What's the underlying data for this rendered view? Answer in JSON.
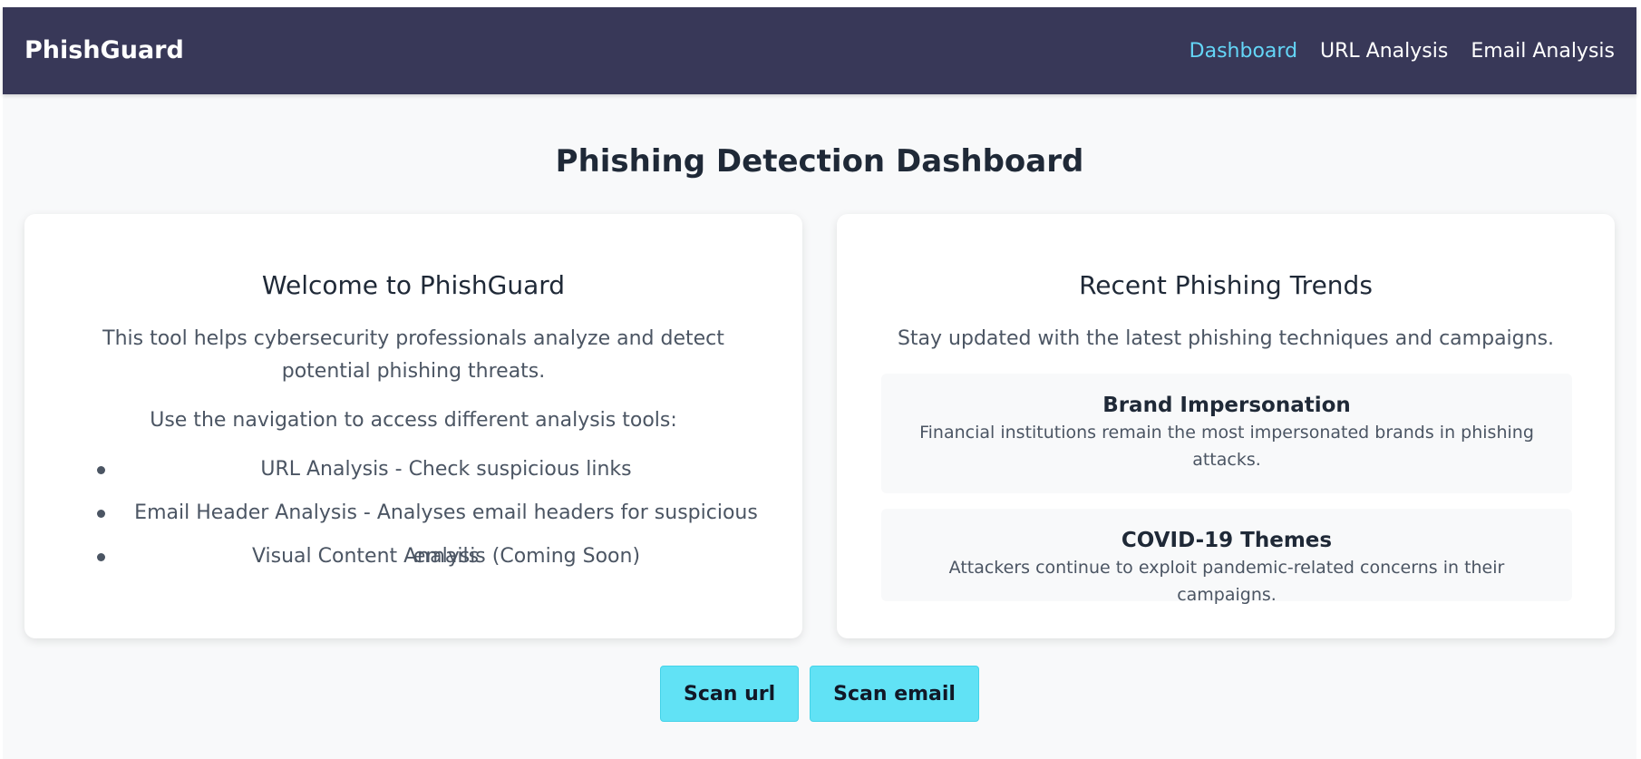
{
  "navbar": {
    "brand": "PhishGuard",
    "links": [
      {
        "label": "Dashboard",
        "active": true
      },
      {
        "label": "URL Analysis",
        "active": false
      },
      {
        "label": "Email Analysis",
        "active": false
      }
    ]
  },
  "page": {
    "title": "Phishing Detection Dashboard"
  },
  "welcome_card": {
    "title": "Welcome to PhishGuard",
    "intro": "This tool helps cybersecurity professionals analyze and detect potential phishing threats.",
    "nav_hint": "Use the navigation to access different analysis tools:",
    "tools": [
      "URL Analysis - Check suspicious links",
      "Email Header Analysis - Analyses email headers for suspicious emails",
      "Visual Content Analysis (Coming Soon)"
    ]
  },
  "trends_card": {
    "title": "Recent Phishing Trends",
    "intro": "Stay updated with the latest phishing techniques and campaigns.",
    "trends": [
      {
        "title": "Brand Impersonation",
        "description": "Financial institutions remain the most impersonated brands in phishing attacks."
      },
      {
        "title": "COVID-19 Themes",
        "description": "Attackers continue to exploit pandemic-related concerns in their campaigns."
      }
    ]
  },
  "actions": {
    "scan_url": "Scan url",
    "scan_email": "Scan email"
  },
  "colors": {
    "navbar_bg": "#383858",
    "active_link": "#64d6f7",
    "button_bg": "#61e2f5",
    "page_bg": "#f8f9fa"
  }
}
